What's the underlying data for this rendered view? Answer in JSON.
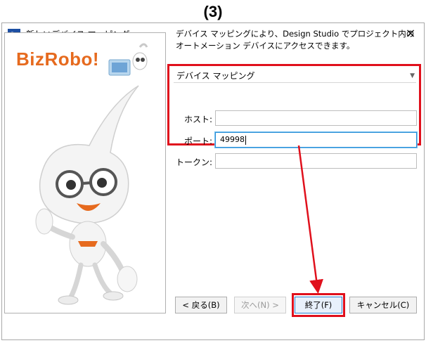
{
  "step_label": "(3)",
  "window": {
    "title": "新しいデバイス マッピング",
    "close_glyph": "×",
    "logo_text": "BizRobo!"
  },
  "description": {
    "line1": "デバイス マッピングにより、Design Studio でプロジェクト内の",
    "line2": "オートメーション デバイスにアクセスできます。"
  },
  "form": {
    "dropdown_label": "デバイス マッピング",
    "host_label": "ホスト:",
    "host_value": "",
    "port_label": "ポート:",
    "port_value": "49998",
    "token_label": "トークン:",
    "token_value": ""
  },
  "buttons": {
    "back": "< 戻る(B)",
    "next": "次へ(N) >",
    "finish": "終了(F)",
    "cancel": "キャンセル(C)"
  },
  "colors": {
    "highlight": "#e0101c",
    "logo_orange": "#e66a1e",
    "focus_blue": "#2b8fd6"
  }
}
